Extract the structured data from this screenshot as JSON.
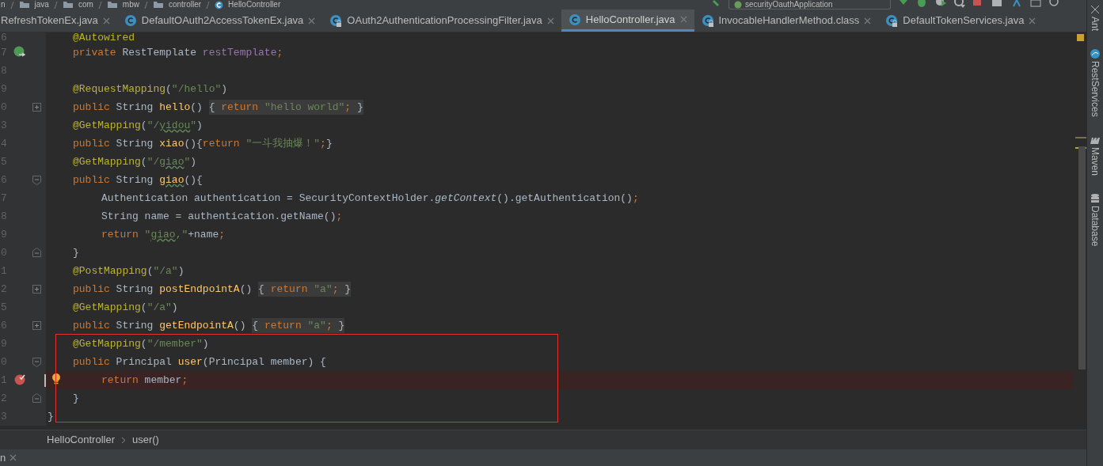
{
  "breadcrumb": [
    "n",
    "java",
    "com",
    "mbw",
    "controller",
    "HelloController"
  ],
  "run_config": "securityOauthApplication",
  "tabs": [
    {
      "label": "RefreshTokenEx.java",
      "selected": false,
      "icon": false
    },
    {
      "label": "DefaultOAuth2AccessTokenEx.java",
      "selected": false,
      "icon": true,
      "locked": false
    },
    {
      "label": "OAuth2AuthenticationProcessingFilter.java",
      "selected": false,
      "icon": true,
      "locked": true
    },
    {
      "label": "HelloController.java",
      "selected": true,
      "icon": true,
      "locked": false
    },
    {
      "label": "InvocableHandlerMethod.class",
      "selected": false,
      "icon": true,
      "locked": true
    },
    {
      "label": "DefaultTokenServices.java",
      "selected": false,
      "icon": true,
      "locked": true
    }
  ],
  "code": [
    {
      "number": "6",
      "kind": "member",
      "tokens": [
        {
          "kind": "ann",
          "text": "@Autowired"
        }
      ]
    },
    {
      "number": "7",
      "kind": "member",
      "gutter": {
        "kind": "bean"
      },
      "tokens": [
        {
          "kind": "kw",
          "text": "private"
        },
        {
          "kind": "plain",
          "text": " RestTemplate "
        },
        {
          "kind": "field",
          "text": "restTemplate"
        },
        {
          "kind": "kw",
          "text": ";"
        }
      ]
    },
    {
      "number": "8",
      "kind": "member"
    },
    {
      "number": "9",
      "kind": "member",
      "tokens": [
        {
          "kind": "ann",
          "text": "@RequestMapping"
        },
        {
          "kind": "plain",
          "text": "("
        },
        {
          "kind": "str",
          "text": "\"/hello\""
        },
        {
          "kind": "plain",
          "text": ")"
        }
      ]
    },
    {
      "number": "0",
      "kind": "member",
      "fold": {
        "kind": "collapsed"
      },
      "tokens": [
        {
          "kind": "kw",
          "text": "public"
        },
        {
          "kind": "plain",
          "text": " String "
        },
        {
          "kind": "def",
          "text": "hello"
        },
        {
          "kind": "plain",
          "text": "() "
        }
      ],
      "folded": [
        {
          "kind": "plain",
          "text": "{ "
        },
        {
          "kind": "kw",
          "text": "return "
        },
        {
          "kind": "str",
          "text": "\"hello world\""
        },
        {
          "kind": "kw",
          "text": ";"
        },
        {
          "kind": "plain",
          "text": " }"
        }
      ]
    },
    {
      "number": "3",
      "kind": "member",
      "tokens": [
        {
          "kind": "ann",
          "text": "@GetMapping"
        },
        {
          "kind": "plain",
          "text": "("
        },
        {
          "kind": "str",
          "text": "\"/"
        },
        {
          "kind": "typo_str",
          "text": "yidou"
        },
        {
          "kind": "str",
          "text": "\""
        },
        {
          "kind": "plain",
          "text": ")"
        }
      ]
    },
    {
      "number": "4",
      "kind": "member",
      "tokens": [
        {
          "kind": "kw",
          "text": "public"
        },
        {
          "kind": "plain",
          "text": " String "
        },
        {
          "kind": "def",
          "text": "xiao"
        },
        {
          "kind": "plain",
          "text": "(){"
        },
        {
          "kind": "kw",
          "text": "return "
        },
        {
          "kind": "str",
          "text": "\"一斗我抽爆！\""
        },
        {
          "kind": "kw",
          "text": ";"
        },
        {
          "kind": "plain",
          "text": "}"
        }
      ]
    },
    {
      "number": "5",
      "kind": "member",
      "tokens": [
        {
          "kind": "ann",
          "text": "@GetMapping"
        },
        {
          "kind": "plain",
          "text": "("
        },
        {
          "kind": "str",
          "text": "\"/"
        },
        {
          "kind": "typo_str",
          "text": "giao"
        },
        {
          "kind": "str",
          "text": "\""
        },
        {
          "kind": "plain",
          "text": ")"
        }
      ]
    },
    {
      "number": "6",
      "kind": "member",
      "fold": {
        "kind": "start"
      },
      "tokens": [
        {
          "kind": "kw",
          "text": "public"
        },
        {
          "kind": "plain",
          "text": " String "
        },
        {
          "kind": "typo_def",
          "text": "giao"
        },
        {
          "kind": "plain",
          "text": "(){"
        }
      ]
    },
    {
      "number": "7",
      "kind": "statement",
      "tokens": [
        {
          "kind": "plain",
          "text": "Authentication authentication = SecurityContextHolder."
        },
        {
          "kind": "ital",
          "text": "getContext"
        },
        {
          "kind": "plain",
          "text": "().getAuthentication()"
        },
        {
          "kind": "kw",
          "text": ";"
        }
      ]
    },
    {
      "number": "8",
      "kind": "statement",
      "tokens": [
        {
          "kind": "plain",
          "text": "String name = authentication.getName()"
        },
        {
          "kind": "kw",
          "text": ";"
        }
      ]
    },
    {
      "number": "9",
      "kind": "statement",
      "tokens": [
        {
          "kind": "kw",
          "text": "return "
        },
        {
          "kind": "str",
          "text": "\""
        },
        {
          "kind": "typo_str",
          "text": "giao"
        },
        {
          "kind": "str",
          "text": ",\""
        },
        {
          "kind": "plain",
          "text": "+name"
        },
        {
          "kind": "kw",
          "text": ";"
        }
      ]
    },
    {
      "number": "0",
      "kind": "member",
      "fold": {
        "kind": "end"
      },
      "tokens": [
        {
          "kind": "plain",
          "text": "}"
        }
      ]
    },
    {
      "number": "1",
      "kind": "member",
      "tokens": [
        {
          "kind": "ann",
          "text": "@PostMapping"
        },
        {
          "kind": "plain",
          "text": "("
        },
        {
          "kind": "str",
          "text": "\"/a\""
        },
        {
          "kind": "plain",
          "text": ")"
        }
      ]
    },
    {
      "number": "2",
      "kind": "member",
      "fold": {
        "kind": "collapsed"
      },
      "tokens": [
        {
          "kind": "kw",
          "text": "public"
        },
        {
          "kind": "plain",
          "text": " String "
        },
        {
          "kind": "def",
          "text": "postEndpointA"
        },
        {
          "kind": "plain",
          "text": "() "
        }
      ],
      "folded": [
        {
          "kind": "plain",
          "text": "{ "
        },
        {
          "kind": "kw",
          "text": "return "
        },
        {
          "kind": "str",
          "text": "\"a\""
        },
        {
          "kind": "kw",
          "text": ";"
        },
        {
          "kind": "plain",
          "text": " }"
        }
      ]
    },
    {
      "number": "5",
      "kind": "member",
      "tokens": [
        {
          "kind": "ann",
          "text": "@GetMapping"
        },
        {
          "kind": "plain",
          "text": "("
        },
        {
          "kind": "str",
          "text": "\"/a\""
        },
        {
          "kind": "plain",
          "text": ")"
        }
      ]
    },
    {
      "number": "6",
      "kind": "member",
      "fold": {
        "kind": "collapsed"
      },
      "tokens": [
        {
          "kind": "kw",
          "text": "public"
        },
        {
          "kind": "plain",
          "text": " String "
        },
        {
          "kind": "def",
          "text": "getEndpointA"
        },
        {
          "kind": "plain",
          "text": "() "
        }
      ],
      "folded": [
        {
          "kind": "plain",
          "text": "{ "
        },
        {
          "kind": "kw",
          "text": "return "
        },
        {
          "kind": "str",
          "text": "\"a\""
        },
        {
          "kind": "kw",
          "text": ";"
        },
        {
          "kind": "plain",
          "text": " }"
        }
      ]
    },
    {
      "number": "9",
      "kind": "member",
      "tokens": [
        {
          "kind": "ann",
          "text": "@GetMapping"
        },
        {
          "kind": "plain",
          "text": "("
        },
        {
          "kind": "str",
          "text": "\"/member\""
        },
        {
          "kind": "plain",
          "text": ")"
        }
      ]
    },
    {
      "number": "0",
      "kind": "member",
      "fold": {
        "kind": "start"
      },
      "tokens": [
        {
          "kind": "kw",
          "text": "public"
        },
        {
          "kind": "plain",
          "text": " Principal "
        },
        {
          "kind": "def",
          "text": "user"
        },
        {
          "kind": "plain",
          "text": "(Principal member) {"
        }
      ]
    },
    {
      "number": "1",
      "kind": "statement",
      "gutter": {
        "kind": "breakpoint"
      },
      "highlighted": true,
      "caret": true,
      "tokens": [
        {
          "kind": "kw",
          "text": "return"
        },
        {
          "kind": "plain",
          "text": " member"
        },
        {
          "kind": "kw",
          "text": ";"
        }
      ]
    },
    {
      "number": "2",
      "kind": "member",
      "fold": {
        "kind": "end"
      },
      "tokens": [
        {
          "kind": "plain",
          "text": "}"
        }
      ]
    },
    {
      "number": "3",
      "kind": "class",
      "tokens": [
        {
          "kind": "plain",
          "text": "}"
        }
      ]
    }
  ],
  "navigation": [
    "HelloController",
    "user()"
  ],
  "tool_windows": [
    "Ant",
    "RestServices",
    "Maven",
    "Database"
  ],
  "status_bar": {
    "tab": "n"
  }
}
